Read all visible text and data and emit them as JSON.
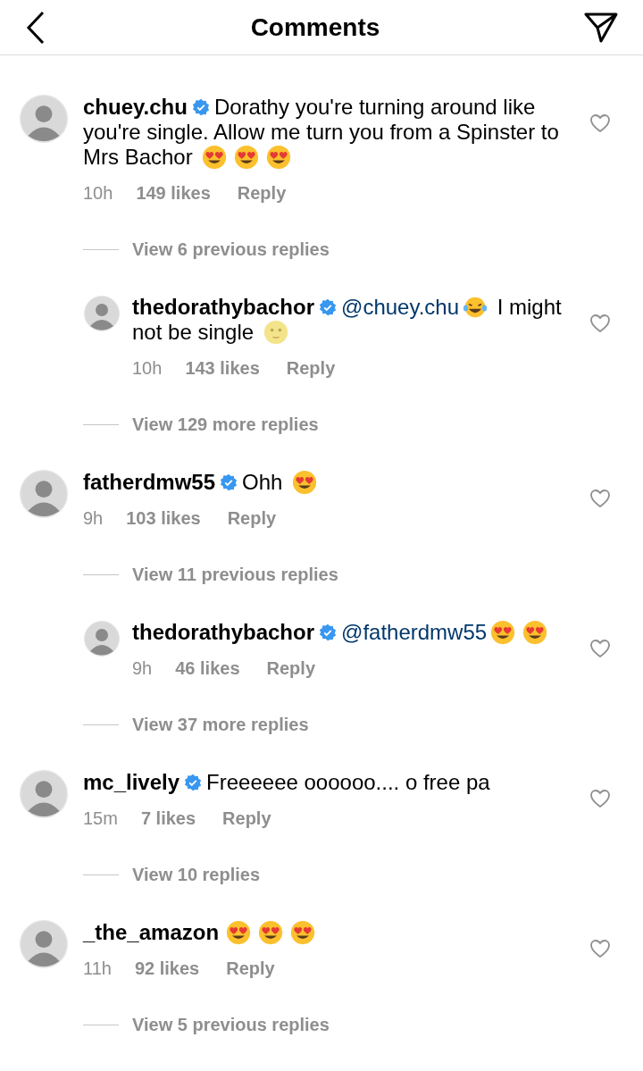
{
  "header": {
    "title": "Comments"
  },
  "feed": [
    {
      "kind": "comment",
      "username": "chuey.chu",
      "verified": true,
      "segments": [
        {
          "kind": "text",
          "text": "Dorathy you're turning around like you're single. Allow me turn you from a Spinster to Mrs Bachor"
        },
        {
          "kind": "hearteyes"
        },
        {
          "kind": "hearteyes"
        },
        {
          "kind": "hearteyes"
        }
      ],
      "time": "10h",
      "likes": "149 likes",
      "reply": "Reply"
    },
    {
      "kind": "view",
      "text": "View 6 previous replies"
    },
    {
      "kind": "reply",
      "username": "thedorathybachor",
      "verified": true,
      "segments": [
        {
          "kind": "mention",
          "text": "@chuey.chu"
        },
        {
          "kind": "laughing"
        },
        {
          "kind": "text",
          "text": "I might not be single"
        },
        {
          "kind": "moon"
        }
      ],
      "time": "10h",
      "likes": "143 likes",
      "reply": "Reply"
    },
    {
      "kind": "view",
      "text": "View 129 more replies"
    },
    {
      "kind": "comment",
      "username": "fatherdmw55",
      "verified": true,
      "segments": [
        {
          "kind": "text",
          "text": "Ohh"
        },
        {
          "kind": "hearteyes"
        }
      ],
      "time": "9h",
      "likes": "103 likes",
      "reply": "Reply"
    },
    {
      "kind": "view",
      "text": "View 11 previous replies"
    },
    {
      "kind": "reply",
      "username": "thedorathybachor",
      "verified": true,
      "segments": [
        {
          "kind": "mention",
          "text": "@fatherdmw55"
        },
        {
          "kind": "hearteyes"
        },
        {
          "kind": "hearteyes"
        }
      ],
      "time": "9h",
      "likes": "46 likes",
      "reply": "Reply"
    },
    {
      "kind": "view",
      "text": "View 37 more replies"
    },
    {
      "kind": "comment",
      "username": "mc_lively",
      "verified": true,
      "segments": [
        {
          "kind": "text",
          "text": "Freeeeee oooooo.... o free pa"
        }
      ],
      "time": "15m",
      "likes": "7 likes",
      "reply": "Reply"
    },
    {
      "kind": "view",
      "text": "View 10 replies"
    },
    {
      "kind": "comment",
      "username": "_the_amazon",
      "verified": false,
      "segments": [
        {
          "kind": "hearteyes"
        },
        {
          "kind": "hearteyes"
        },
        {
          "kind": "hearteyes"
        }
      ],
      "time": "11h",
      "likes": "92 likes",
      "reply": "Reply"
    },
    {
      "kind": "view",
      "text": "View 5 previous replies"
    }
  ]
}
